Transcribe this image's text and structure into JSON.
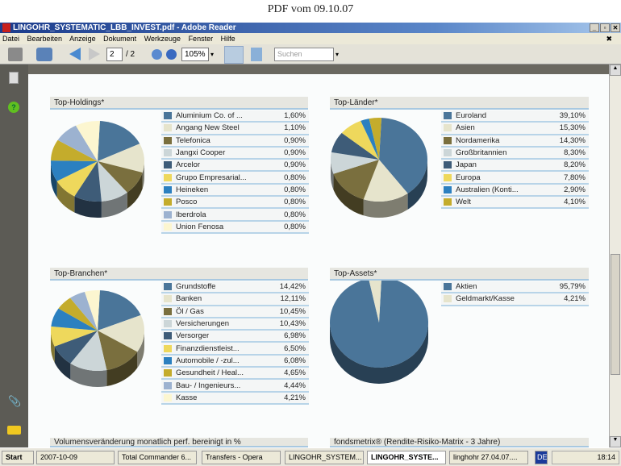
{
  "caption": "PDF vom 09.10.07",
  "window": {
    "title": "LINGOHR_SYSTEMATIC_LBB_INVEST.pdf - Adobe Reader"
  },
  "menu": [
    "Datei",
    "Bearbeiten",
    "Anzeige",
    "Dokument",
    "Werkzeuge",
    "Fenster",
    "Hilfe"
  ],
  "toolbar": {
    "page": "2",
    "page_total": "/ 2",
    "zoom": "105%",
    "search_placeholder": "Suchen"
  },
  "chart_data": [
    {
      "type": "pie",
      "title": "Top-Holdings*",
      "categories": [
        "Aluminium Co. of ...",
        "Angang New Steel",
        "Telefonica",
        "Jangxi Cooper",
        "Arcelor",
        "Grupo Empresarial...",
        "Heineken",
        "Posco",
        "Iberdrola",
        "Union Fenosa"
      ],
      "labels": [
        "1,60%",
        "1,10%",
        "0,90%",
        "0,90%",
        "0,90%",
        "0,80%",
        "0,80%",
        "0,80%",
        "0,80%",
        "0,80%"
      ],
      "values": [
        1.6,
        1.1,
        0.9,
        0.9,
        0.9,
        0.8,
        0.8,
        0.8,
        0.8,
        0.8
      ]
    },
    {
      "type": "pie",
      "title": "Top-Länder*",
      "categories": [
        "Euroland",
        "Asien",
        "Nordamerika",
        "Großbritannien",
        "Japan",
        "Europa",
        "Australien (Konti...",
        "Welt"
      ],
      "labels": [
        "39,10%",
        "15,30%",
        "14,30%",
        "8,30%",
        "8,20%",
        "7,80%",
        "2,90%",
        "4,10%"
      ],
      "values": [
        39.1,
        15.3,
        14.3,
        8.3,
        8.2,
        7.8,
        2.9,
        4.1
      ]
    },
    {
      "type": "pie",
      "title": "Top-Branchen*",
      "categories": [
        "Grundstoffe",
        "Banken",
        "Öl / Gas",
        "Versicherungen",
        "Versorger",
        "Finanzdienstleist...",
        "Automobile / -zul...",
        "Gesundheit / Heal...",
        "Bau- / Ingenieurs...",
        "Kasse"
      ],
      "labels": [
        "14,42%",
        "12,11%",
        "10,45%",
        "10,43%",
        "6,98%",
        "6,50%",
        "6,08%",
        "4,65%",
        "4,44%",
        "4,21%"
      ],
      "values": [
        14.42,
        12.11,
        10.45,
        10.43,
        6.98,
        6.5,
        6.08,
        4.65,
        4.44,
        4.21
      ]
    },
    {
      "type": "pie",
      "title": "Top-Assets*",
      "categories": [
        "Aktien",
        "Geldmarkt/Kasse"
      ],
      "labels": [
        "95,79%",
        "4,21%"
      ],
      "values": [
        95.79,
        4.21
      ]
    }
  ],
  "colors": [
    "#4a7599",
    "#e6e4cc",
    "#7a6f3e",
    "#ccd6d8",
    "#3e5c78",
    "#eed85c",
    "#2b80c0",
    "#c4ac2c",
    "#9cb2d0",
    "#fcf6d0"
  ],
  "bottom_headers": [
    "Volumensveränderung monatlich perf. bereinigt in %",
    "fondsmetrix® (Rendite-Risiko-Matrix - 3 Jahre)"
  ],
  "taskbar": {
    "start": "Start",
    "tasks": [
      "2007-10-09",
      "Total Commander 6...",
      "Transfers - Opera",
      "LINGOHR_SYSTEM...",
      "LINGOHR_SYSTE...",
      "linghohr 27.04.07...."
    ],
    "lang": "DE",
    "clock": "18:14"
  }
}
